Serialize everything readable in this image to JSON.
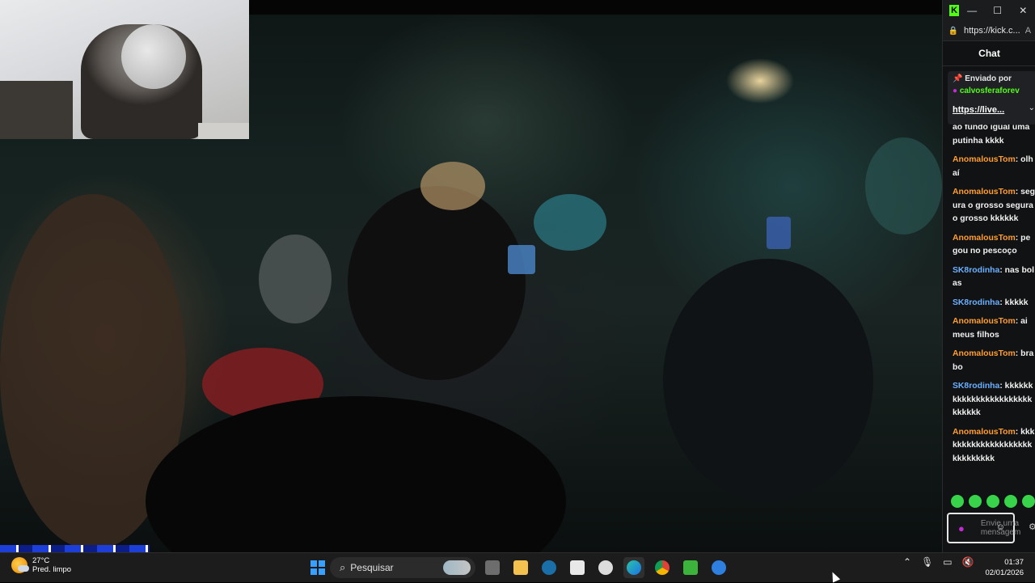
{
  "chat_window": {
    "url": "https://kick.c...",
    "aa_label": "A",
    "title": "Chat",
    "pinned": {
      "label": "Enviado por",
      "user": "calvosferaforev",
      "link": "https://live..."
    },
    "messages": [
      {
        "user": "",
        "user_color": "none",
        "text": "ao fundo igual uma putinha kkkk"
      },
      {
        "user": "AnomalousTom",
        "user_color": "orange",
        "text": "olhaí"
      },
      {
        "user": "AnomalousTom",
        "user_color": "orange",
        "text": "segura o grosso segura o grosso kkkkkk"
      },
      {
        "user": "AnomalousTom",
        "user_color": "orange",
        "text": "pegou no pescoço"
      },
      {
        "user": "SK8rodinha",
        "user_color": "blue",
        "text": "nas bolas"
      },
      {
        "user": "SK8rodinha",
        "user_color": "blue",
        "text": "kkkkk"
      },
      {
        "user": "AnomalousTom",
        "user_color": "orange",
        "text": "ai meus filhos"
      },
      {
        "user": "AnomalousTom",
        "user_color": "orange",
        "text": "brabo"
      },
      {
        "user": "SK8rodinha",
        "user_color": "blue",
        "text": "kkkkkkkkkkkkkkkkkkkkkkkkkkkkk"
      },
      {
        "user": "AnomalousTom",
        "user_color": "orange",
        "text": "kkkkkkkkkkkkkkkkkkkkkkkkkkkkk"
      }
    ],
    "input_placeholder": "Envie uma mensagem"
  },
  "taskbar": {
    "weather": {
      "temp": "27°C",
      "desc": "Pred. limpo"
    },
    "search_placeholder": "Pesquisar",
    "apps": [
      "file-explorer",
      "folder",
      "steam",
      "epic-games",
      "chatgpt",
      "edge",
      "chrome",
      "xbox",
      "browser"
    ],
    "clock": {
      "time": "01:37",
      "date": "02/01/2026"
    }
  },
  "colors": {
    "kick_green": "#53fc18",
    "username_orange": "#ff9d2e",
    "username_blue": "#6bb0ff",
    "taskbar_bg": "#1c1c1c"
  }
}
